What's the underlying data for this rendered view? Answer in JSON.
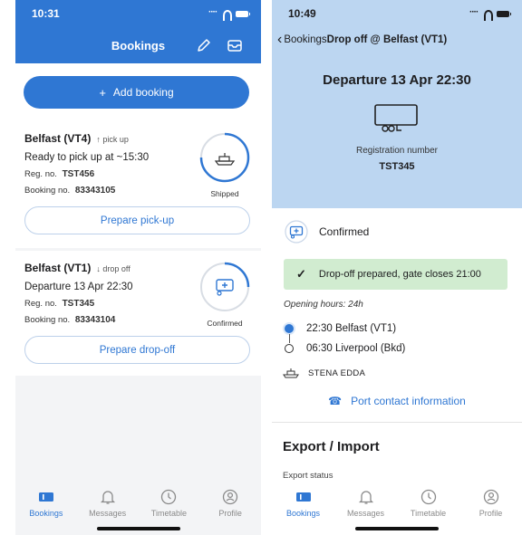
{
  "left": {
    "status_time": "10:31",
    "header_title": "Bookings",
    "add_booking_label": "Add booking",
    "bookings": [
      {
        "location": "Belfast (VT4)",
        "direction": "↑ pick up",
        "summary": "Ready to pick up at ~15:30",
        "reg_label": "Reg. no.",
        "reg_value": "TST456",
        "booking_label": "Booking no.",
        "booking_value": "83343105",
        "status": "Shipped",
        "status_icon": "ferry-icon",
        "action_label": "Prepare pick-up"
      },
      {
        "location": "Belfast (VT1)",
        "direction": "↓ drop off",
        "summary": "Departure 13 Apr 22:30",
        "reg_label": "Reg. no.",
        "reg_value": "TST345",
        "booking_label": "Booking no.",
        "booking_value": "83343104",
        "status": "Confirmed",
        "status_icon": "trailer-confirmed-icon",
        "action_label": "Prepare drop-off"
      }
    ]
  },
  "right": {
    "status_time": "10:49",
    "back_label": "Bookings",
    "nav_title": "Drop off @ Belfast (VT1)",
    "departure": "Departure 13 Apr 22:30",
    "reg_label": "Registration number",
    "reg_value": "TST345",
    "status": "Confirmed",
    "banner": "Drop-off prepared, gate closes 21:00",
    "opening_hours": "Opening hours: 24h",
    "route": [
      {
        "time_place": "22:30 Belfast (VT1)"
      },
      {
        "time_place": "06:30 Liverpool (Bkd)"
      }
    ],
    "ship": "STENA EDDA",
    "contact_label": "Port contact information",
    "section_title": "Export / Import",
    "section_sub": "Export status"
  },
  "tabs": [
    {
      "label": "Bookings",
      "icon": "bookings-icon"
    },
    {
      "label": "Messages",
      "icon": "bell-icon"
    },
    {
      "label": "Timetable",
      "icon": "clock-icon"
    },
    {
      "label": "Profile",
      "icon": "profile-icon"
    }
  ],
  "colors": {
    "brand_blue": "#2f77d3",
    "header_light_blue": "#bcd6f1",
    "success_green": "#d1ecd0"
  }
}
